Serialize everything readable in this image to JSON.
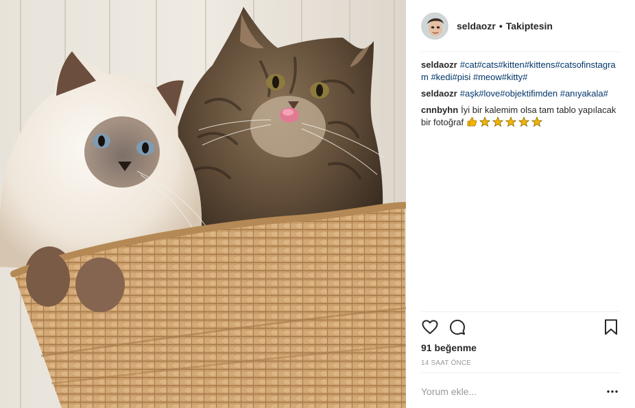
{
  "post": {
    "username": "seldaozr",
    "separator": "•",
    "follow_status": "Takiptesin"
  },
  "comments": [
    {
      "user": "seldaozr",
      "text": "#cat#cats#kitten#kittens#catsofinstagram #kedi#pisi #meow#kitty#",
      "is_tags": true
    },
    {
      "user": "seldaozr",
      "text": "#aşk#love#objektifimden #anıyakala#",
      "is_tags": true
    },
    {
      "user": "cnnbyhn",
      "text": "İyi bir kalemim olsa tam tablo yapılacak bir fotoğraf",
      "is_tags": false
    }
  ],
  "emojis": [
    "thumbs-up",
    "star",
    "star",
    "star",
    "star",
    "star"
  ],
  "likes": "91 beğenme",
  "time_ago": "14 SAAT ÖNCE",
  "add_comment": {
    "placeholder": "Yorum ekle..."
  },
  "icons": {
    "like": "heart-icon",
    "comment": "comment-bubble-icon",
    "save": "bookmark-icon",
    "more": "more-options-icon"
  },
  "colors": {
    "hashtag": "#003569",
    "text": "#262626",
    "muted": "#999999",
    "divider": "#efefef",
    "star": "#f4b400"
  }
}
